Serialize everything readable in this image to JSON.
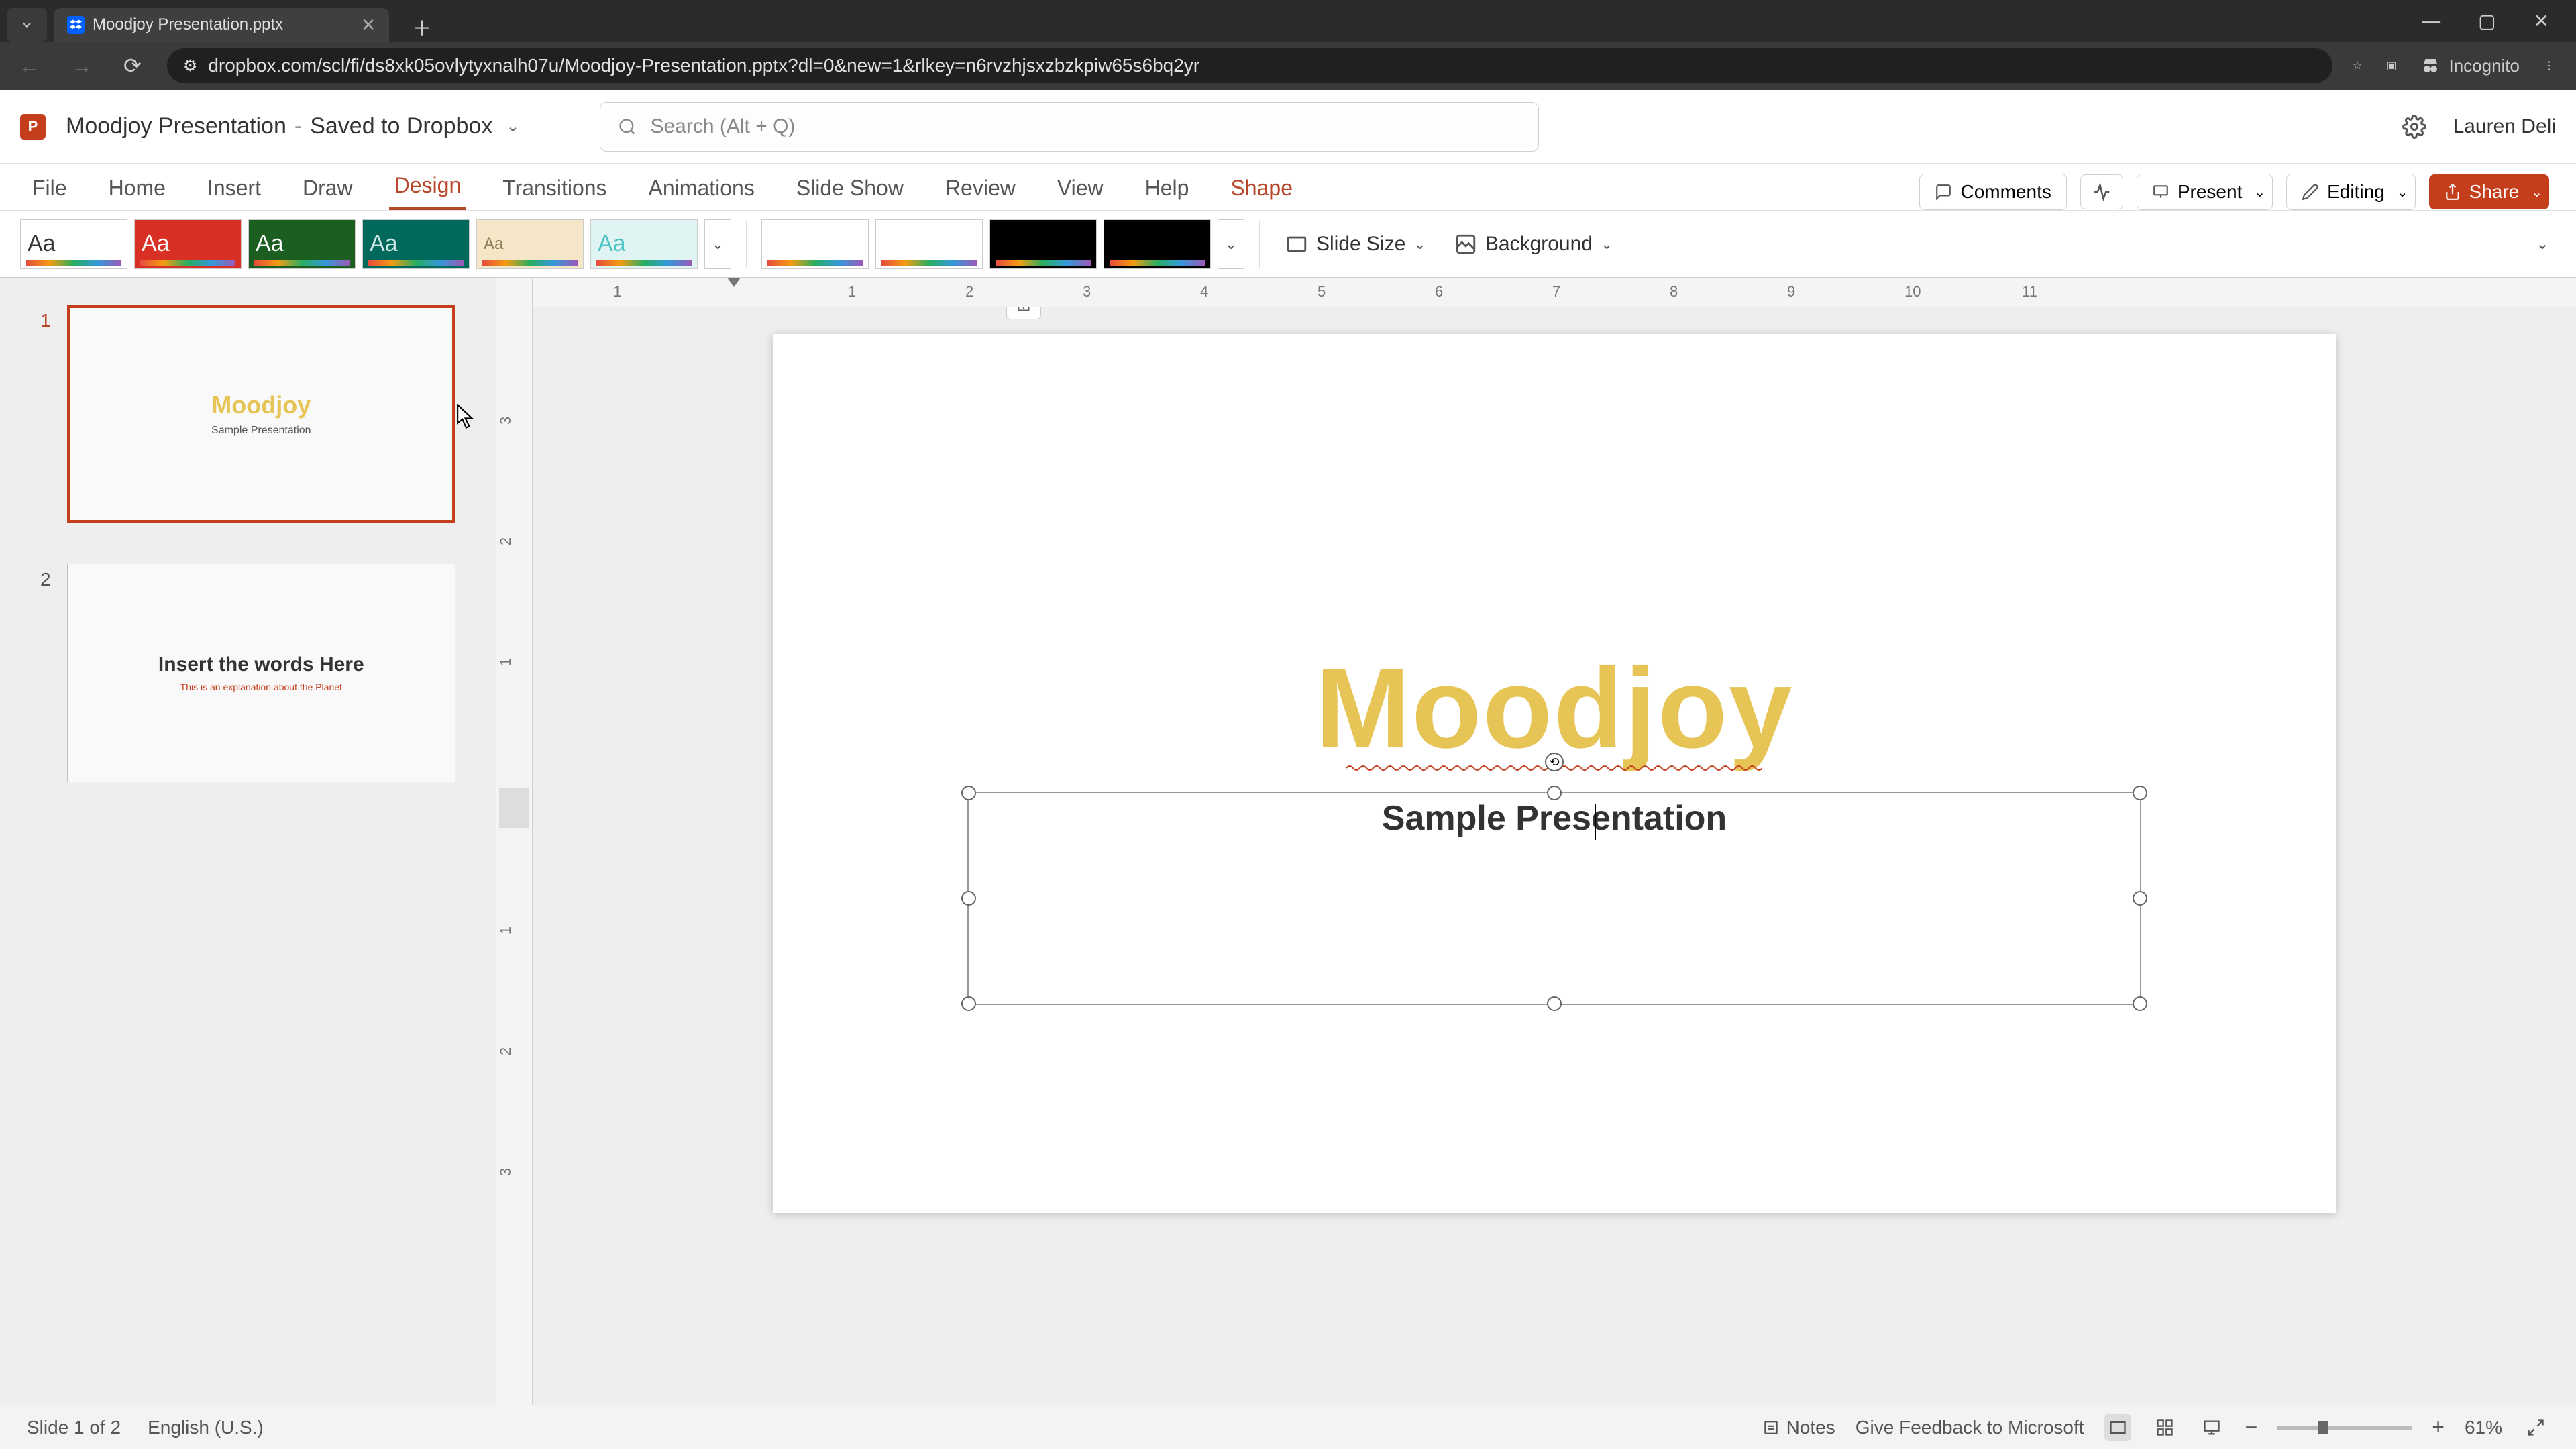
{
  "browser": {
    "tab_title": "Moodjoy Presentation.pptx",
    "url": "dropbox.com/scl/fi/ds8xk05ovlytyxnalh07u/Moodjoy-Presentation.pptx?dl=0&new=1&rlkey=n6rvzhjsxzbzkpiw65s6bq2yr",
    "incognito": "Incognito"
  },
  "header": {
    "doc_name": "Moodjoy Presentation",
    "save_state": "Saved to Dropbox",
    "search_placeholder": "Search (Alt + Q)",
    "user": "Lauren Deli"
  },
  "ribbon": {
    "tabs": [
      "File",
      "Home",
      "Insert",
      "Draw",
      "Design",
      "Transitions",
      "Animations",
      "Slide Show",
      "Review",
      "View",
      "Help",
      "Shape"
    ],
    "active_tab": "Design",
    "comments": "Comments",
    "present": "Present",
    "editing": "Editing",
    "share": "Share"
  },
  "design_bar": {
    "slide_size": "Slide Size",
    "background": "Background"
  },
  "slides": [
    {
      "num": "1",
      "title": "Moodjoy",
      "subtitle": "Sample Presentation",
      "title_color": "#e6c455"
    },
    {
      "num": "2",
      "title": "Insert the words Here",
      "subtitle": "This is an explanation about the Planet",
      "title_color": "#333",
      "sub_color": "#c43e1c"
    }
  ],
  "canvas": {
    "title": "Moodjoy",
    "subtitle": "Sample Presentation"
  },
  "ruler_h": [
    "1",
    "1",
    "2",
    "3",
    "4",
    "5",
    "6",
    "7",
    "8",
    "9",
    "10",
    "11"
  ],
  "ruler_v": [
    "3",
    "2",
    "1",
    "1",
    "2",
    "3"
  ],
  "status": {
    "slide_info": "Slide 1 of 2",
    "language": "English (U.S.)",
    "notes": "Notes",
    "feedback": "Give Feedback to Microsoft",
    "zoom": "61%"
  }
}
